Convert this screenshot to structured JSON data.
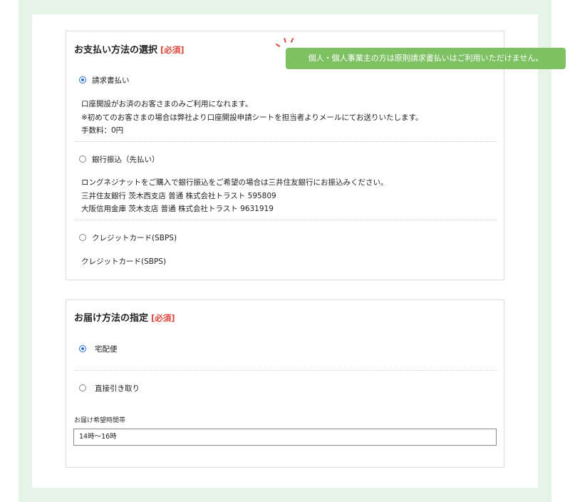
{
  "payment": {
    "title": "お支払い方法の選択",
    "required": "[必須]",
    "notice": "個人・個人事業主の方は原則請求書払いはご利用いただけません。",
    "options": [
      {
        "label": "請求書払い",
        "checked": true,
        "desc": [
          "口座開設がお済のお客さまのみご利用になれます。",
          "※初めてのお客さまの場合は弊社より口座開設申請シートを担当者よりメールにてお送りいたします。",
          "手数料：0円"
        ]
      },
      {
        "label": "銀行振込（先払い）",
        "checked": false,
        "desc": [
          "ロングネジナットをご購入で銀行振込をご希望の場合は三井住友銀行にお振込みください。",
          "三井住友銀行 茨木西支店 普通 株式会社トラスト 595809",
          "大阪信用金庫 茨木支店 普通 株式会社トラスト 9631919"
        ]
      },
      {
        "label": "クレジットカード(SBPS)",
        "checked": false,
        "desc": [
          "クレジットカード(SBPS)"
        ]
      }
    ]
  },
  "delivery": {
    "title": "お届け方法の指定",
    "required": "[必須]",
    "options": [
      {
        "label": "宅配便",
        "checked": true
      },
      {
        "label": "直接引き取り",
        "checked": false
      }
    ],
    "time_label": "お届け希望時間帯",
    "time_value": "14時〜16時"
  },
  "colors": {
    "page_bg": "#e6f4e8",
    "required": "#e0453a",
    "notice_bg": "#7ec163",
    "radio": "#2a6fdb"
  }
}
